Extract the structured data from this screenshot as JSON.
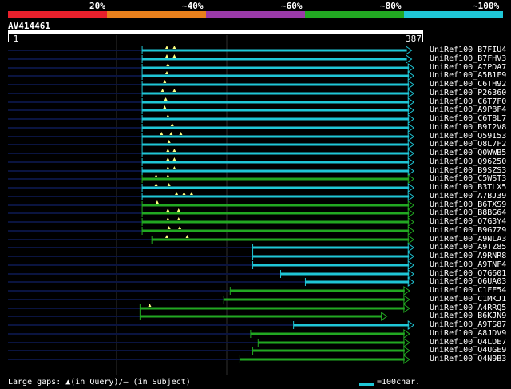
{
  "header": {
    "scale_labels": [
      "20%",
      "~40%",
      "~60%",
      "~80%",
      "~100%"
    ],
    "color_segments": [
      "#e8202c",
      "#e8801c",
      "#9a3aa8",
      "#22a822",
      "#1fc6d6"
    ],
    "query_id": "AV414461",
    "query_start": "1",
    "query_end": "387",
    "query_length": 387
  },
  "legend": {
    "gaps_text": "Large gaps: ▲(in Query)/– (in Subject)",
    "scale_text": "=100char."
  },
  "colors": {
    "cyan": "#1fc6d6",
    "green": "#22a822",
    "background": "#000000",
    "grid": "#303030",
    "tail": "#0a1440",
    "gap_marker": "#ffff80"
  },
  "hits": [
    {
      "name": "UniRef100_B7FIU4",
      "color": "cyan",
      "start": 126,
      "end": 377,
      "gaps": [
        149,
        156
      ]
    },
    {
      "name": "UniRef100_B7FHV3",
      "color": "cyan",
      "start": 126,
      "end": 377,
      "gaps": [
        149,
        156
      ]
    },
    {
      "name": "UniRef100_A7PDA7",
      "color": "cyan",
      "start": 126,
      "end": 379,
      "gaps": [
        150
      ]
    },
    {
      "name": "UniRef100_A5B1F9",
      "color": "cyan",
      "start": 126,
      "end": 379,
      "gaps": [
        149
      ]
    },
    {
      "name": "UniRef100_C6TH92",
      "color": "cyan",
      "start": 126,
      "end": 379,
      "gaps": [
        147
      ]
    },
    {
      "name": "UniRef100_P26360",
      "color": "cyan",
      "start": 126,
      "end": 379,
      "gaps": [
        145,
        156
      ]
    },
    {
      "name": "UniRef100_C6T7F0",
      "color": "cyan",
      "start": 126,
      "end": 379,
      "gaps": [
        148
      ]
    },
    {
      "name": "UniRef100_A9PBF4",
      "color": "cyan",
      "start": 126,
      "end": 379,
      "gaps": [
        147
      ]
    },
    {
      "name": "UniRef100_C6T8L7",
      "color": "cyan",
      "start": 126,
      "end": 379,
      "gaps": [
        150
      ]
    },
    {
      "name": "UniRef100_B9I2V8",
      "color": "cyan",
      "start": 126,
      "end": 379,
      "gaps": [
        154
      ]
    },
    {
      "name": "UniRef100_Q59I53",
      "color": "cyan",
      "start": 126,
      "end": 379,
      "gaps": [
        144,
        153,
        162
      ]
    },
    {
      "name": "UniRef100_Q8L7F2",
      "color": "cyan",
      "start": 126,
      "end": 379,
      "gaps": [
        151
      ]
    },
    {
      "name": "UniRef100_Q0WWB5",
      "color": "cyan",
      "start": 126,
      "end": 379,
      "gaps": [
        150,
        156
      ]
    },
    {
      "name": "UniRef100_Q96250",
      "color": "cyan",
      "start": 126,
      "end": 379,
      "gaps": [
        150,
        156
      ]
    },
    {
      "name": "UniRef100_B9SZS3",
      "color": "cyan",
      "start": 126,
      "end": 379,
      "gaps": [
        150,
        156
      ]
    },
    {
      "name": "UniRef100_C5WST3",
      "color": "green",
      "start": 126,
      "end": 379,
      "gaps": [
        139,
        150
      ]
    },
    {
      "name": "UniRef100_B3TLX5",
      "color": "cyan",
      "start": 126,
      "end": 379,
      "gaps": [
        139,
        151
      ]
    },
    {
      "name": "UniRef100_A7BJ39",
      "color": "cyan",
      "start": 126,
      "end": 379,
      "gaps": [
        158,
        165,
        172
      ]
    },
    {
      "name": "UniRef100_B6TXS9",
      "color": "green",
      "start": 126,
      "end": 379,
      "gaps": [
        140
      ]
    },
    {
      "name": "UniRef100_B8BG64",
      "color": "green",
      "start": 126,
      "end": 379,
      "gaps": [
        150,
        160
      ]
    },
    {
      "name": "UniRef100_Q7G3Y4",
      "color": "green",
      "start": 126,
      "end": 379,
      "gaps": [
        150,
        160
      ]
    },
    {
      "name": "UniRef100_B9G7Z9",
      "color": "green",
      "start": 126,
      "end": 379,
      "gaps": [
        151,
        161
      ]
    },
    {
      "name": "UniRef100_A9NLA3",
      "color": "green",
      "start": 135,
      "end": 379,
      "gaps": [
        149,
        168
      ]
    },
    {
      "name": "UniRef100_A9TZ85",
      "color": "cyan",
      "start": 229,
      "end": 379,
      "gaps": []
    },
    {
      "name": "UniRef100_A9RNR8",
      "color": "cyan",
      "start": 229,
      "end": 379,
      "gaps": []
    },
    {
      "name": "UniRef100_A9TNF4",
      "color": "cyan",
      "start": 229,
      "end": 379,
      "gaps": []
    },
    {
      "name": "UniRef100_Q7G601",
      "color": "cyan",
      "start": 255,
      "end": 379,
      "gaps": []
    },
    {
      "name": "UniRef100_Q6UA03",
      "color": "cyan",
      "start": 278,
      "end": 379,
      "gaps": []
    },
    {
      "name": "UniRef100_C1FE54",
      "color": "green",
      "start": 208,
      "end": 375,
      "gaps": []
    },
    {
      "name": "UniRef100_C1MKJ1",
      "color": "green",
      "start": 202,
      "end": 375,
      "gaps": []
    },
    {
      "name": "UniRef100_A4RRQ5",
      "color": "green",
      "start": 124,
      "end": 375,
      "gaps": [
        133
      ]
    },
    {
      "name": "UniRef100_B6KJN9",
      "color": "green",
      "start": 124,
      "end": 354,
      "gaps": []
    },
    {
      "name": "UniRef100_A9TS87",
      "color": "cyan",
      "start": 267,
      "end": 379,
      "gaps": []
    },
    {
      "name": "UniRef100_A8JDV9",
      "color": "green",
      "start": 227,
      "end": 375,
      "gaps": []
    },
    {
      "name": "UniRef100_Q4LDE7",
      "color": "green",
      "start": 234,
      "end": 375,
      "gaps": []
    },
    {
      "name": "UniRef100_Q4UGE9",
      "color": "green",
      "start": 229,
      "end": 375,
      "gaps": []
    },
    {
      "name": "UniRef100_Q4N9B3",
      "color": "green",
      "start": 217,
      "end": 375,
      "gaps": []
    }
  ]
}
